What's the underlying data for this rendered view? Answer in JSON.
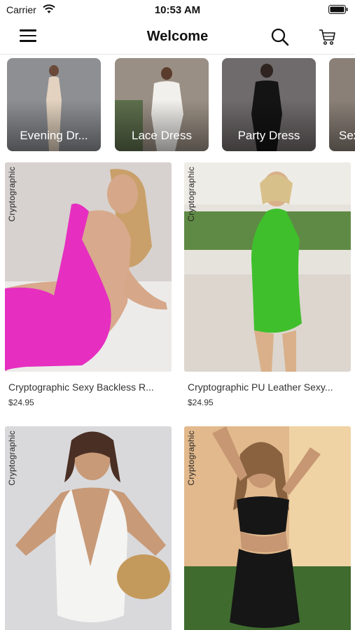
{
  "status_bar": {
    "carrier": "Carrier",
    "time": "10:53 AM",
    "wifi_icon": "wifi-icon",
    "battery_icon": "battery-icon"
  },
  "nav": {
    "title": "Welcome",
    "menu_icon": "hamburger-menu-icon",
    "search_icon": "search-icon",
    "cart_icon": "cart-icon"
  },
  "categories": [
    {
      "label": "Evening Dr...",
      "bg": "#8d8f93"
    },
    {
      "label": "Lace Dress",
      "bg": "#9a8f84"
    },
    {
      "label": "Party Dress",
      "bg": "#6f6a6b"
    },
    {
      "label": "Sex",
      "bg": "#8a8077"
    }
  ],
  "products": [
    {
      "name": "Cryptographic Sexy Backless R...",
      "price": "$24.95",
      "watermark": "Cryptographic",
      "dress_color": "#e62fc0",
      "bg": "#d7d2cf"
    },
    {
      "name": "Cryptographic PU Leather Sexy...",
      "price": "$24.95",
      "watermark": "Cryptographic",
      "dress_color": "#3fbf2c",
      "bg": "#e6e3dd"
    },
    {
      "name": "",
      "price": "",
      "watermark": "Cryptographic",
      "dress_color": "#f4f4f2",
      "bg": "#d9d9dc"
    },
    {
      "name": "",
      "price": "",
      "watermark": "Cryptographic",
      "dress_color": "#161616",
      "bg": "#e2b98c"
    }
  ]
}
